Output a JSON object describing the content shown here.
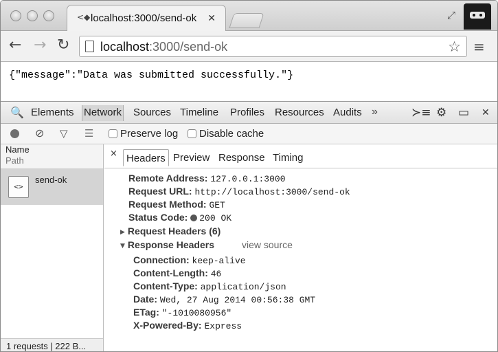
{
  "browser": {
    "tab_title": "localhost:3000/send-ok",
    "tab_close": "✕",
    "url_host": "localhost",
    "url_rest": ":3000/send-ok"
  },
  "page": {
    "body_text": "{\"message\":\"Data was submitted successfully.\"}"
  },
  "devtools": {
    "tabs": [
      "Elements",
      "Network",
      "Sources",
      "Timeline",
      "Profiles",
      "Resources",
      "Audits"
    ],
    "active_tab": "Network",
    "more": "»",
    "network_toolbar": {
      "preserve_log": "Preserve log",
      "disable_cache": "Disable cache"
    },
    "request_list": {
      "col_name": "Name",
      "col_path": "Path",
      "items": [
        {
          "name": "send-ok",
          "icon_text": "<>"
        }
      ],
      "summary": "1 requests | 222 B..."
    },
    "detail": {
      "close": "×",
      "tabs": [
        "Headers",
        "Preview",
        "Response",
        "Timing"
      ],
      "active_tab": "Headers",
      "general": [
        {
          "key": "Remote Address:",
          "value": "127.0.0.1:3000"
        },
        {
          "key": "Request URL:",
          "value": "http://localhost:3000/send-ok"
        },
        {
          "key": "Request Method:",
          "value": "GET"
        },
        {
          "key": "Status Code:",
          "value": "200 OK"
        }
      ],
      "request_headers_label": "Request Headers (6)",
      "response_headers_label": "Response Headers",
      "view_source": "view source",
      "response_headers": [
        {
          "key": "Connection:",
          "value": "keep-alive"
        },
        {
          "key": "Content-Length:",
          "value": "46"
        },
        {
          "key": "Content-Type:",
          "value": "application/json"
        },
        {
          "key": "Date:",
          "value": "Wed, 27 Aug 2014 00:56:38 GMT"
        },
        {
          "key": "ETag:",
          "value": "\"-1010080956\""
        },
        {
          "key": "X-Powered-By:",
          "value": "Express"
        }
      ]
    }
  },
  "icons": {
    "back": "arrow-left-icon",
    "forward": "arrow-right-icon",
    "reload": "reload-icon",
    "star": "star-icon",
    "menu": "hamburger-menu-icon",
    "record": "record-icon",
    "clear": "clear-icon",
    "filter": "filter-icon",
    "status_dot_color": "#555555"
  }
}
